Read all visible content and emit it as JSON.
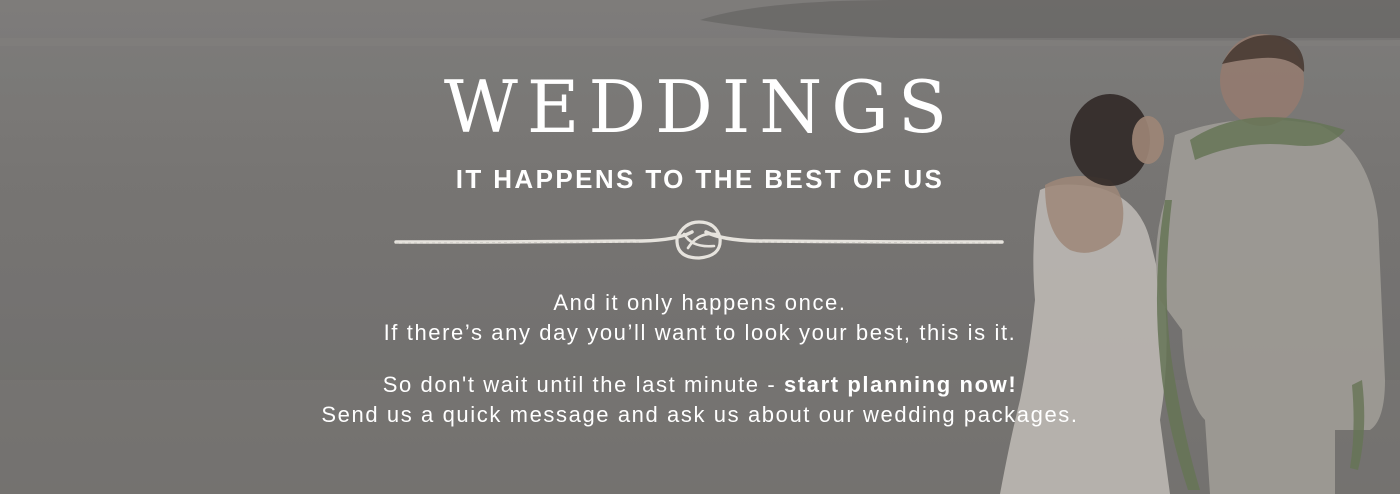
{
  "hero": {
    "title": "WEDDINGS",
    "subtitle": "IT HAPPENS TO THE BEST OF US",
    "paragraph1": {
      "line1": "And it only happens once.",
      "line2": "If there’s any day you’ll want to look your best, this is it."
    },
    "paragraph2": {
      "line1_prefix": "So don't wait until the last minute - ",
      "line1_emphasis": "start planning now!",
      "line2": "Send us a quick message and ask us about our wedding packages."
    },
    "divider_icon": "rope-knot-icon",
    "colors": {
      "text": "#ffffff",
      "overlay": "#7a7876",
      "rope": "#e6e3dd"
    }
  }
}
